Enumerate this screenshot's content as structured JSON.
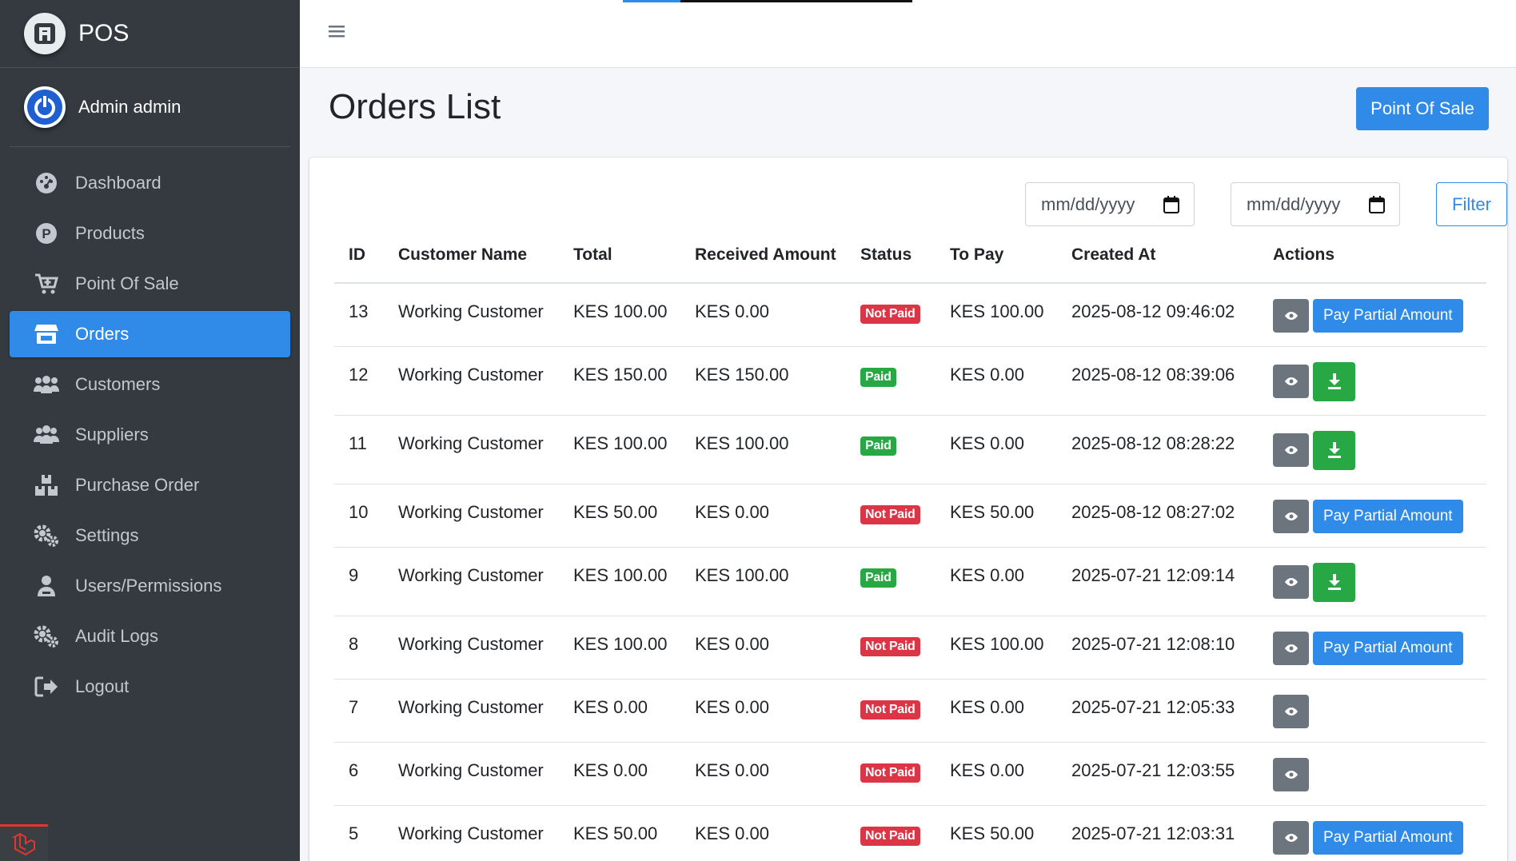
{
  "app": {
    "brand": "POS",
    "user": "Admin admin"
  },
  "sidebar": {
    "items": [
      {
        "label": "Dashboard",
        "icon": "dashboard-icon",
        "active": false
      },
      {
        "label": "Products",
        "icon": "products-icon",
        "active": false
      },
      {
        "label": "Point Of Sale",
        "icon": "cart-icon",
        "active": false
      },
      {
        "label": "Orders",
        "icon": "store-icon",
        "active": true
      },
      {
        "label": "Customers",
        "icon": "customers-icon",
        "active": false
      },
      {
        "label": "Suppliers",
        "icon": "suppliers-icon",
        "active": false
      },
      {
        "label": "Purchase Order",
        "icon": "boxes-icon",
        "active": false
      },
      {
        "label": "Settings",
        "icon": "cogs-icon",
        "active": false
      },
      {
        "label": "Users/Permissions",
        "icon": "user-icon",
        "active": false
      },
      {
        "label": "Audit Logs",
        "icon": "cogs-icon",
        "active": false
      },
      {
        "label": "Logout",
        "icon": "logout-icon",
        "active": false
      }
    ]
  },
  "page": {
    "title": "Orders List",
    "pos_button": "Point Of Sale"
  },
  "filters": {
    "start_date_placeholder": "mm/dd/yyyy",
    "end_date_placeholder": "mm/dd/yyyy",
    "filter_label": "Filter"
  },
  "table": {
    "headers": [
      "ID",
      "Customer Name",
      "Total",
      "Received Amount",
      "Status",
      "To Pay",
      "Created At",
      "Actions"
    ],
    "rows": [
      {
        "id": "13",
        "customer": "Working Customer",
        "total": "KES 100.00",
        "received": "KES 0.00",
        "status": "Not Paid",
        "to_pay": "KES 100.00",
        "created": "2025-08-12 09:46:02",
        "action": "pay"
      },
      {
        "id": "12",
        "customer": "Working Customer",
        "total": "KES 150.00",
        "received": "KES 150.00",
        "status": "Paid",
        "to_pay": "KES 0.00",
        "created": "2025-08-12 08:39:06",
        "action": "download"
      },
      {
        "id": "11",
        "customer": "Working Customer",
        "total": "KES 100.00",
        "received": "KES 100.00",
        "status": "Paid",
        "to_pay": "KES 0.00",
        "created": "2025-08-12 08:28:22",
        "action": "download"
      },
      {
        "id": "10",
        "customer": "Working Customer",
        "total": "KES 50.00",
        "received": "KES 0.00",
        "status": "Not Paid",
        "to_pay": "KES 50.00",
        "created": "2025-08-12 08:27:02",
        "action": "pay"
      },
      {
        "id": "9",
        "customer": "Working Customer",
        "total": "KES 100.00",
        "received": "KES 100.00",
        "status": "Paid",
        "to_pay": "KES 0.00",
        "created": "2025-07-21 12:09:14",
        "action": "download"
      },
      {
        "id": "8",
        "customer": "Working Customer",
        "total": "KES 100.00",
        "received": "KES 0.00",
        "status": "Not Paid",
        "to_pay": "KES 100.00",
        "created": "2025-07-21 12:08:10",
        "action": "pay"
      },
      {
        "id": "7",
        "customer": "Working Customer",
        "total": "KES 0.00",
        "received": "KES 0.00",
        "status": "Not Paid",
        "to_pay": "KES 0.00",
        "created": "2025-07-21 12:05:33",
        "action": "none"
      },
      {
        "id": "6",
        "customer": "Working Customer",
        "total": "KES 0.00",
        "received": "KES 0.00",
        "status": "Not Paid",
        "to_pay": "KES 0.00",
        "created": "2025-07-21 12:03:55",
        "action": "none"
      },
      {
        "id": "5",
        "customer": "Working Customer",
        "total": "KES 50.00",
        "received": "KES 0.00",
        "status": "Not Paid",
        "to_pay": "KES 50.00",
        "created": "2025-07-21 12:03:31",
        "action": "pay"
      }
    ],
    "pay_label": "Pay Partial Amount"
  },
  "colors": {
    "sidebar": "#343a40",
    "primary": "#2f8ae8",
    "success": "#28a745",
    "danger": "#dc3545",
    "secondary": "#6c757d"
  }
}
